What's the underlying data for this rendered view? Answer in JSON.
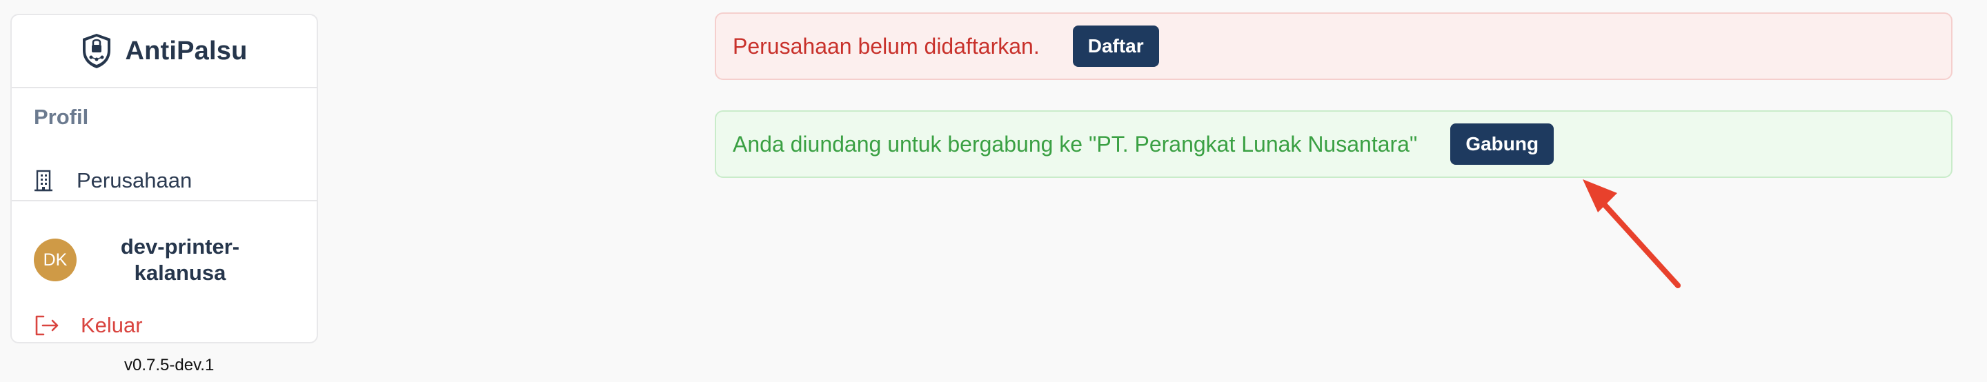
{
  "sidebar": {
    "brand": {
      "name": "AntiPalsu",
      "logo_icon": "shield-lock-icon"
    },
    "section_label": "Profil",
    "nav_items": [
      {
        "label": "Perusahaan",
        "icon": "building-icon"
      }
    ],
    "user": {
      "initials": "DK",
      "name": "dev-printer-kalanusa"
    },
    "logout": {
      "label": "Keluar",
      "icon": "logout-icon"
    },
    "version": "v0.7.5-dev.1"
  },
  "alerts": [
    {
      "message": "Perusahaan belum didaftarkan.",
      "button_label": "Daftar",
      "tone": "error"
    },
    {
      "message": "Anda diundang untuk bergabung ke \"PT. Perangkat Lunak Nusantara\"",
      "button_label": "Gabung",
      "tone": "success"
    }
  ],
  "colors": {
    "primary_button": "#1e3a5f",
    "error_text": "#c8312b",
    "success_text": "#3aa043",
    "avatar": "#cf9a46",
    "annotation_arrow": "#e8412c"
  }
}
